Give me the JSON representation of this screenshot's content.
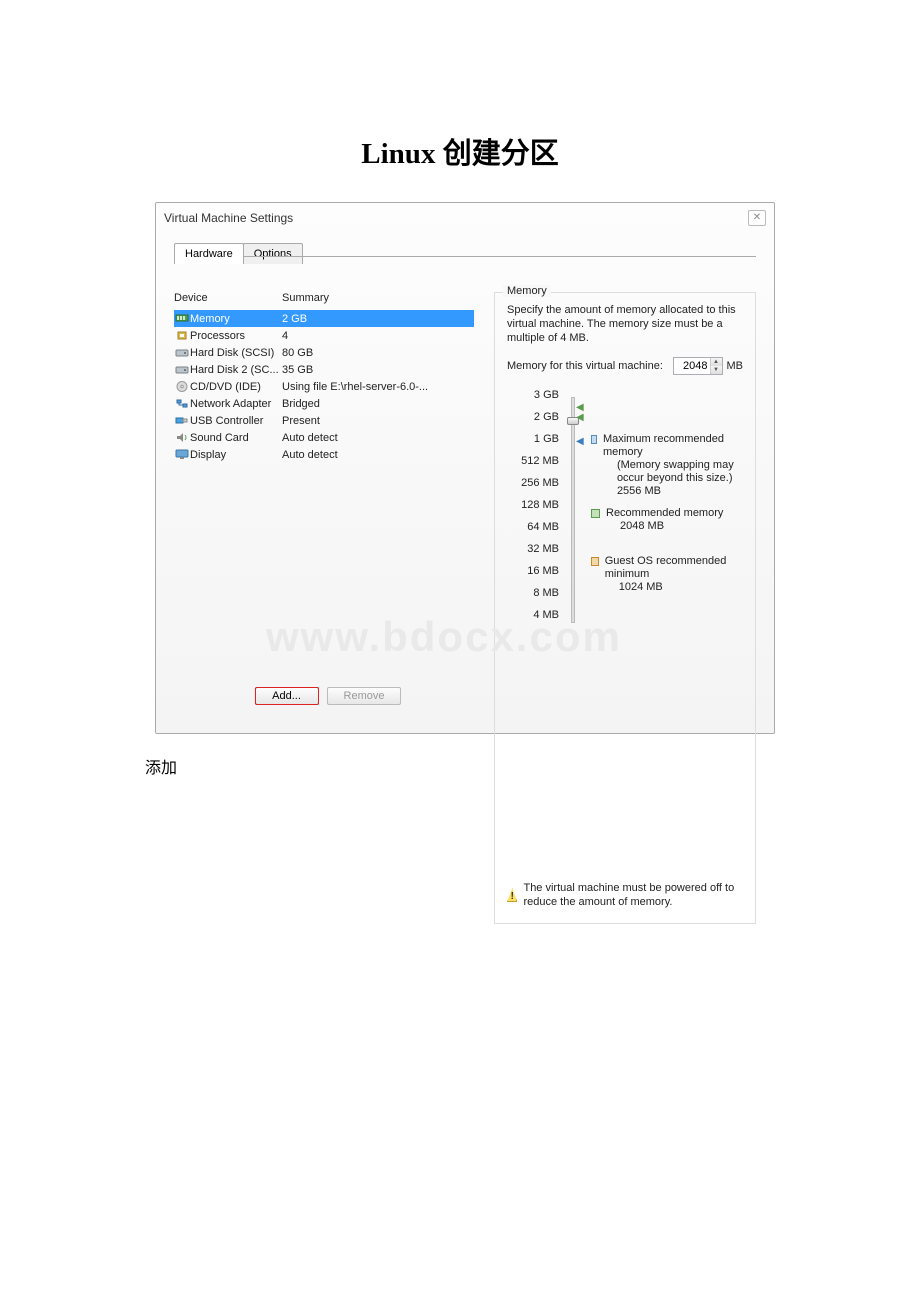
{
  "title": "Linux 创建分区",
  "dialog_title": "Virtual Machine Settings",
  "close_symbol": "✕",
  "tabs": {
    "hardware": "Hardware",
    "options": "Options"
  },
  "headers": {
    "device": "Device",
    "summary": "Summary"
  },
  "devices": [
    {
      "name": "Memory",
      "summary": "2 GB",
      "icon": "memory"
    },
    {
      "name": "Processors",
      "summary": "4",
      "icon": "cpu"
    },
    {
      "name": "Hard Disk (SCSI)",
      "summary": "80 GB",
      "icon": "hdd"
    },
    {
      "name": "Hard Disk 2 (SC...",
      "summary": "35 GB",
      "icon": "hdd"
    },
    {
      "name": "CD/DVD (IDE)",
      "summary": "Using file E:\\rhel-server-6.0-...",
      "icon": "cd"
    },
    {
      "name": "Network Adapter",
      "summary": "Bridged",
      "icon": "net"
    },
    {
      "name": "USB Controller",
      "summary": "Present",
      "icon": "usb"
    },
    {
      "name": "Sound Card",
      "summary": "Auto detect",
      "icon": "sound"
    },
    {
      "name": "Display",
      "summary": "Auto detect",
      "icon": "display"
    }
  ],
  "memory_panel": {
    "group_label": "Memory",
    "description": "Specify the amount of memory allocated to this virtual machine. The memory size must be a multiple of 4 MB.",
    "allocation_label": "Memory for this virtual machine:",
    "value": "2048",
    "unit": "MB",
    "scale": [
      "3 GB",
      "2 GB",
      "1 GB",
      "512 MB",
      "256 MB",
      "128 MB",
      "64 MB",
      "32 MB",
      "16 MB",
      "8 MB",
      "4 MB"
    ],
    "max_label": "Maximum recommended memory",
    "max_note": "(Memory swapping may occur beyond this size.)",
    "max_value": "2556 MB",
    "rec_label": "Recommended memory",
    "rec_value": "2048 MB",
    "min_label": "Guest OS recommended minimum",
    "min_value": "1024 MB",
    "warning_text": "The virtual machine must be powered off to reduce the amount of memory."
  },
  "buttons": {
    "add": "Add...",
    "remove": "Remove"
  },
  "watermark": "www.bdocx.com",
  "caption": "添加"
}
